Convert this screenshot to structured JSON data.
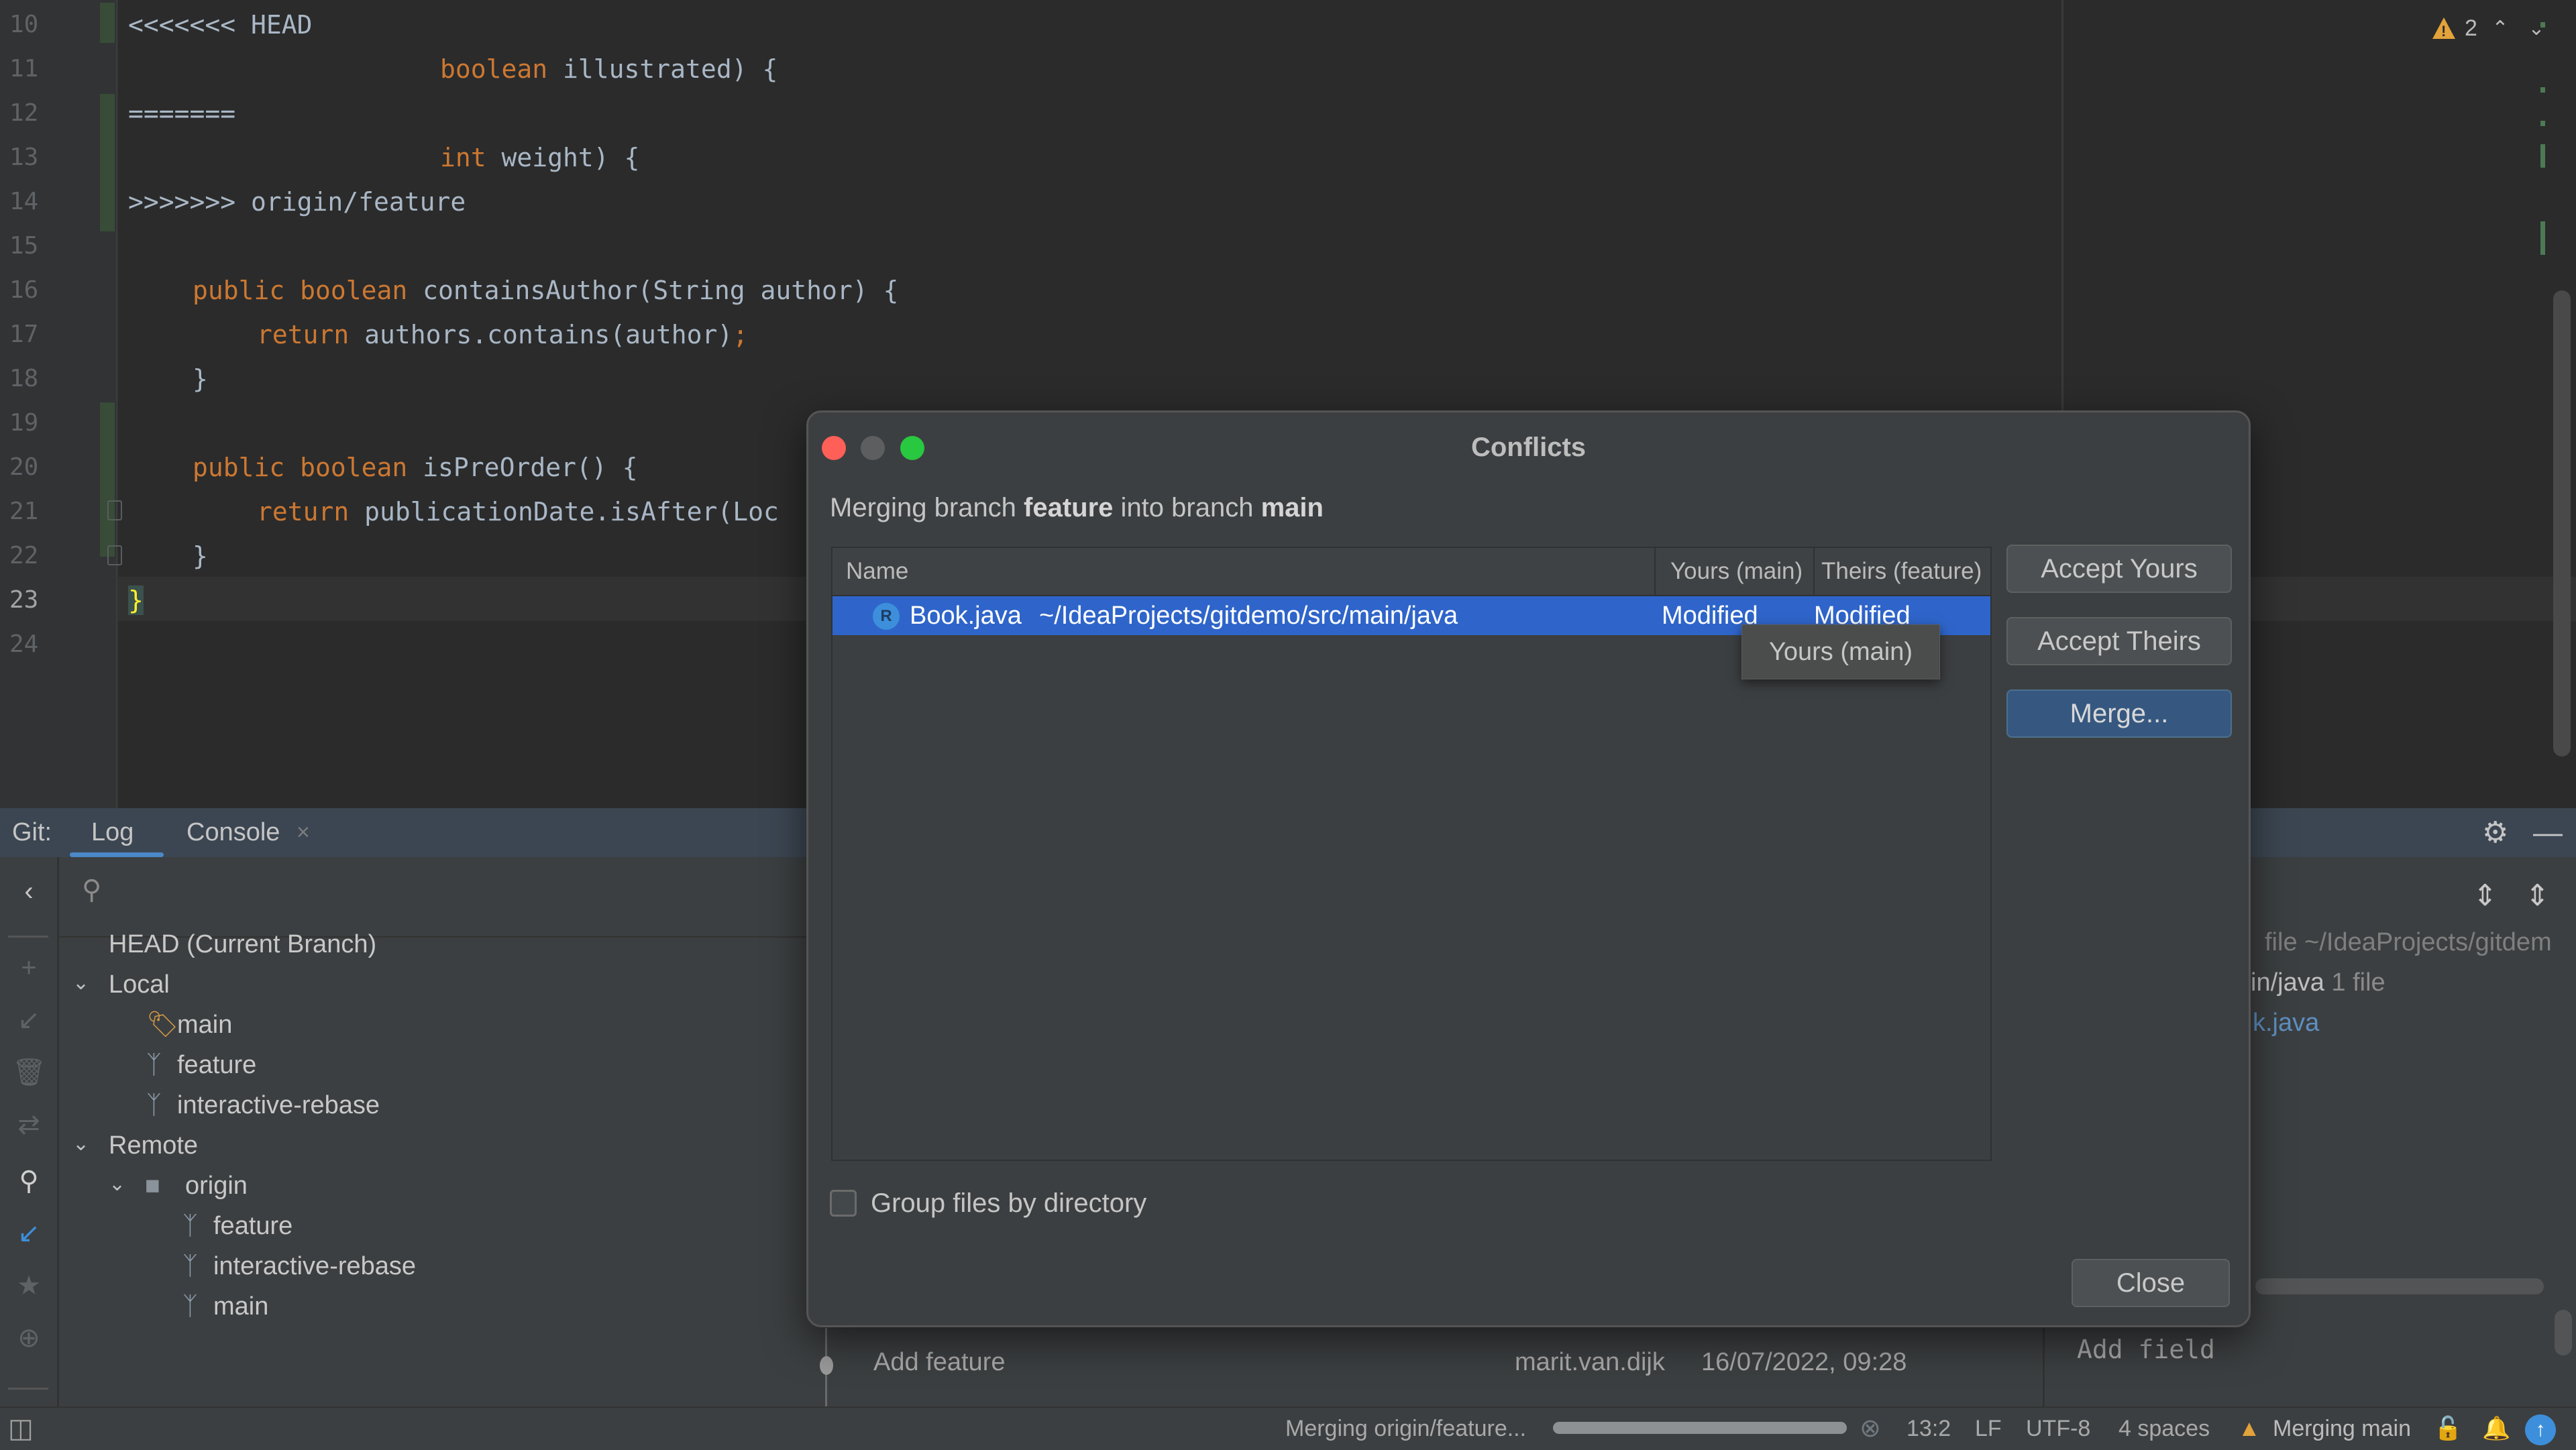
{
  "editor": {
    "lines": [
      {
        "num": "10",
        "text": "<<<<<<< HEAD"
      },
      {
        "num": "11",
        "kw": "boolean",
        "text": " illustrated) {"
      },
      {
        "num": "12",
        "text": "======="
      },
      {
        "num": "13",
        "kw": "int",
        "text": " weight) {"
      },
      {
        "num": "14",
        "text": ">>>>>>> origin/feature"
      },
      {
        "num": "15",
        "text": ""
      },
      {
        "num": "16",
        "kw": "public boolean",
        "text": " containsAuthor(String author) {"
      },
      {
        "num": "17",
        "kw": "return",
        "text": " authors.contains(author)",
        "semi": ";"
      },
      {
        "num": "18",
        "text": "}"
      },
      {
        "num": "19",
        "text": ""
      },
      {
        "num": "20",
        "kw": "public boolean",
        "text": " isPreOrder() {"
      },
      {
        "num": "21",
        "kw": "return",
        "text": " publicationDate.isAfter(Loc"
      },
      {
        "num": "22",
        "text": "}"
      },
      {
        "num": "23",
        "text": "}"
      },
      {
        "num": "24",
        "text": ""
      }
    ],
    "current_line": "23",
    "warnings_count": "2",
    "warning_icon": "warning-triangle-icon",
    "prev_arrow": "⌃",
    "next_arrow": "⌄"
  },
  "git_window": {
    "label": "Git:",
    "tabs": [
      {
        "label": "Log",
        "active": true
      },
      {
        "label": "Console",
        "closable": true,
        "close_glyph": "×"
      }
    ],
    "branch_tree": {
      "head": "HEAD (Current Branch)",
      "local_label": "Local",
      "local": [
        {
          "name": "main",
          "icon": "tag-icon"
        },
        {
          "name": "feature",
          "icon": "branch-icon"
        },
        {
          "name": "interactive-rebase",
          "icon": "branch-icon"
        }
      ],
      "remote_label": "Remote",
      "origin_label": "origin",
      "remote": [
        {
          "name": "feature"
        },
        {
          "name": "interactive-rebase"
        },
        {
          "name": "main"
        }
      ]
    },
    "log_rows": [
      {
        "message": "Add feature",
        "author": "marit.van.dijk",
        "date": "16/07/2022, 09:28"
      }
    ],
    "details_panel": {
      "line1": "file ~/IdeaProjects/gitdem",
      "line2_path": "in/java",
      "line2_count": "1 file",
      "line3": "k.java",
      "commit_message": "Add field"
    }
  },
  "dialog": {
    "title": "Conflicts",
    "subtitle_prefix": "Merging branch ",
    "source_branch": "feature",
    "subtitle_middle": " into branch ",
    "target_branch": "main",
    "columns": [
      "Name",
      "Yours (main)",
      "Theirs (feature)"
    ],
    "rows": [
      {
        "file": "Book.java",
        "path": "~/IdeaProjects/gitdemo/src/main/java",
        "yours": "Modified",
        "theirs": "Modified",
        "icon_letter": "R"
      }
    ],
    "tooltip": "Yours (main)",
    "buttons": {
      "accept_yours": "Accept Yours",
      "accept_theirs": "Accept Theirs",
      "merge": "Merge...",
      "close": "Close"
    },
    "group_checkbox_label": "Group files by directory",
    "group_checked": false
  },
  "status_bar": {
    "task": "Merging origin/feature...",
    "progress": 1.0,
    "position": "13:2",
    "line_sep": "LF",
    "encoding": "UTF-8",
    "indent": "4 spaces",
    "vcs_status": "Merging main"
  },
  "colors": {
    "accent": "#4a88c7",
    "selection": "#2f65ca",
    "keyword": "#cc7832",
    "warning": "#e2a33a",
    "primary_button": "#365880"
  }
}
